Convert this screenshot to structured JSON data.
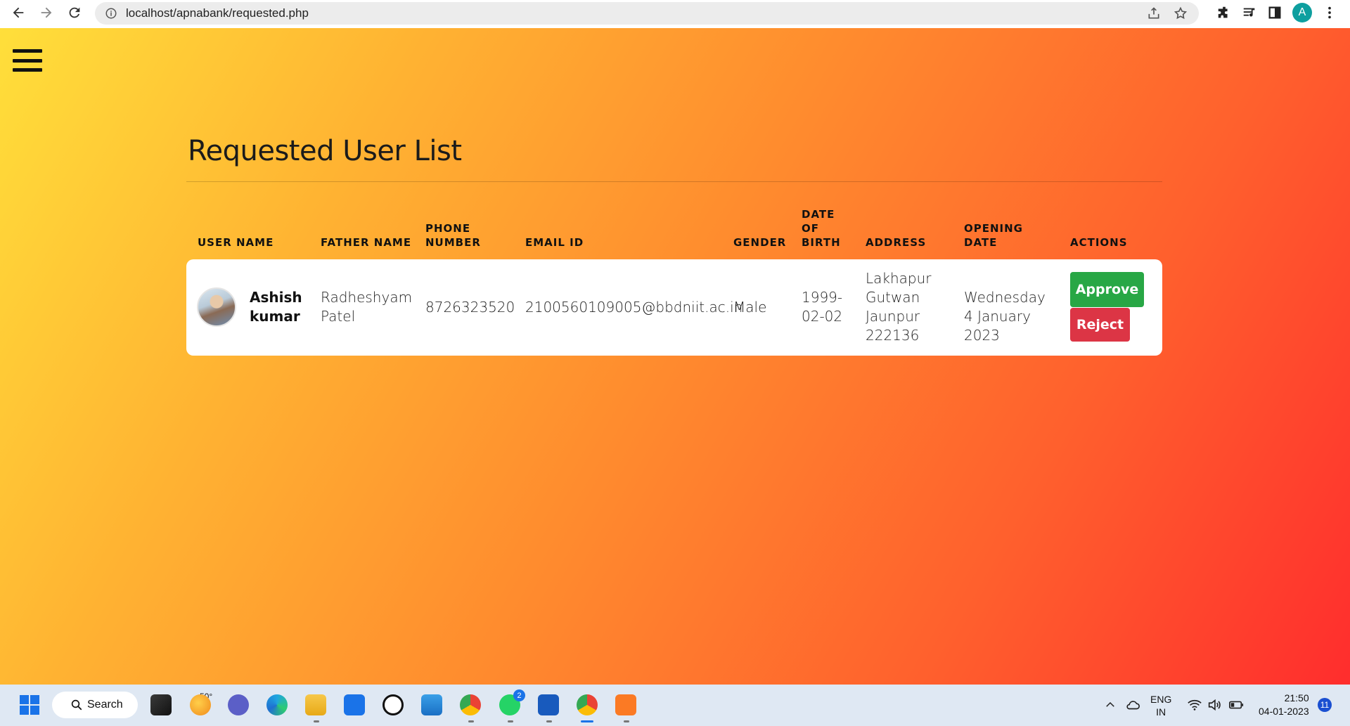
{
  "browser": {
    "url": "localhost/apnabank/requested.php",
    "profile_initial": "A"
  },
  "page": {
    "title": "Requested User List",
    "columns": [
      "USER NAME",
      "FATHER NAME",
      "PHONE NUMBER",
      "EMAIL ID",
      "GENDER",
      "DATE OF BIRTH",
      "ADDRESS",
      "OPENING DATE",
      "ACTIONS"
    ],
    "rows": [
      {
        "user_name": "Ashish kumar",
        "father_name": "Radheshyam Patel",
        "phone": "8726323520",
        "email": "2100560109005@bbdniit.ac.in",
        "gender": "Male",
        "dob": "1999-02-02",
        "address": "Lakhapur Gutwan Jaunpur 222136",
        "opening_date": "Wednesday 4 January 2023",
        "approve_label": "Approve",
        "reject_label": "Reject"
      }
    ]
  },
  "taskbar": {
    "search_label": "Search",
    "weather_temp": "50°",
    "whatsapp_badge": "2",
    "lang_line1": "ENG",
    "lang_line2": "IN",
    "time": "21:50",
    "date": "04-01-2023",
    "notification_count": "11"
  }
}
